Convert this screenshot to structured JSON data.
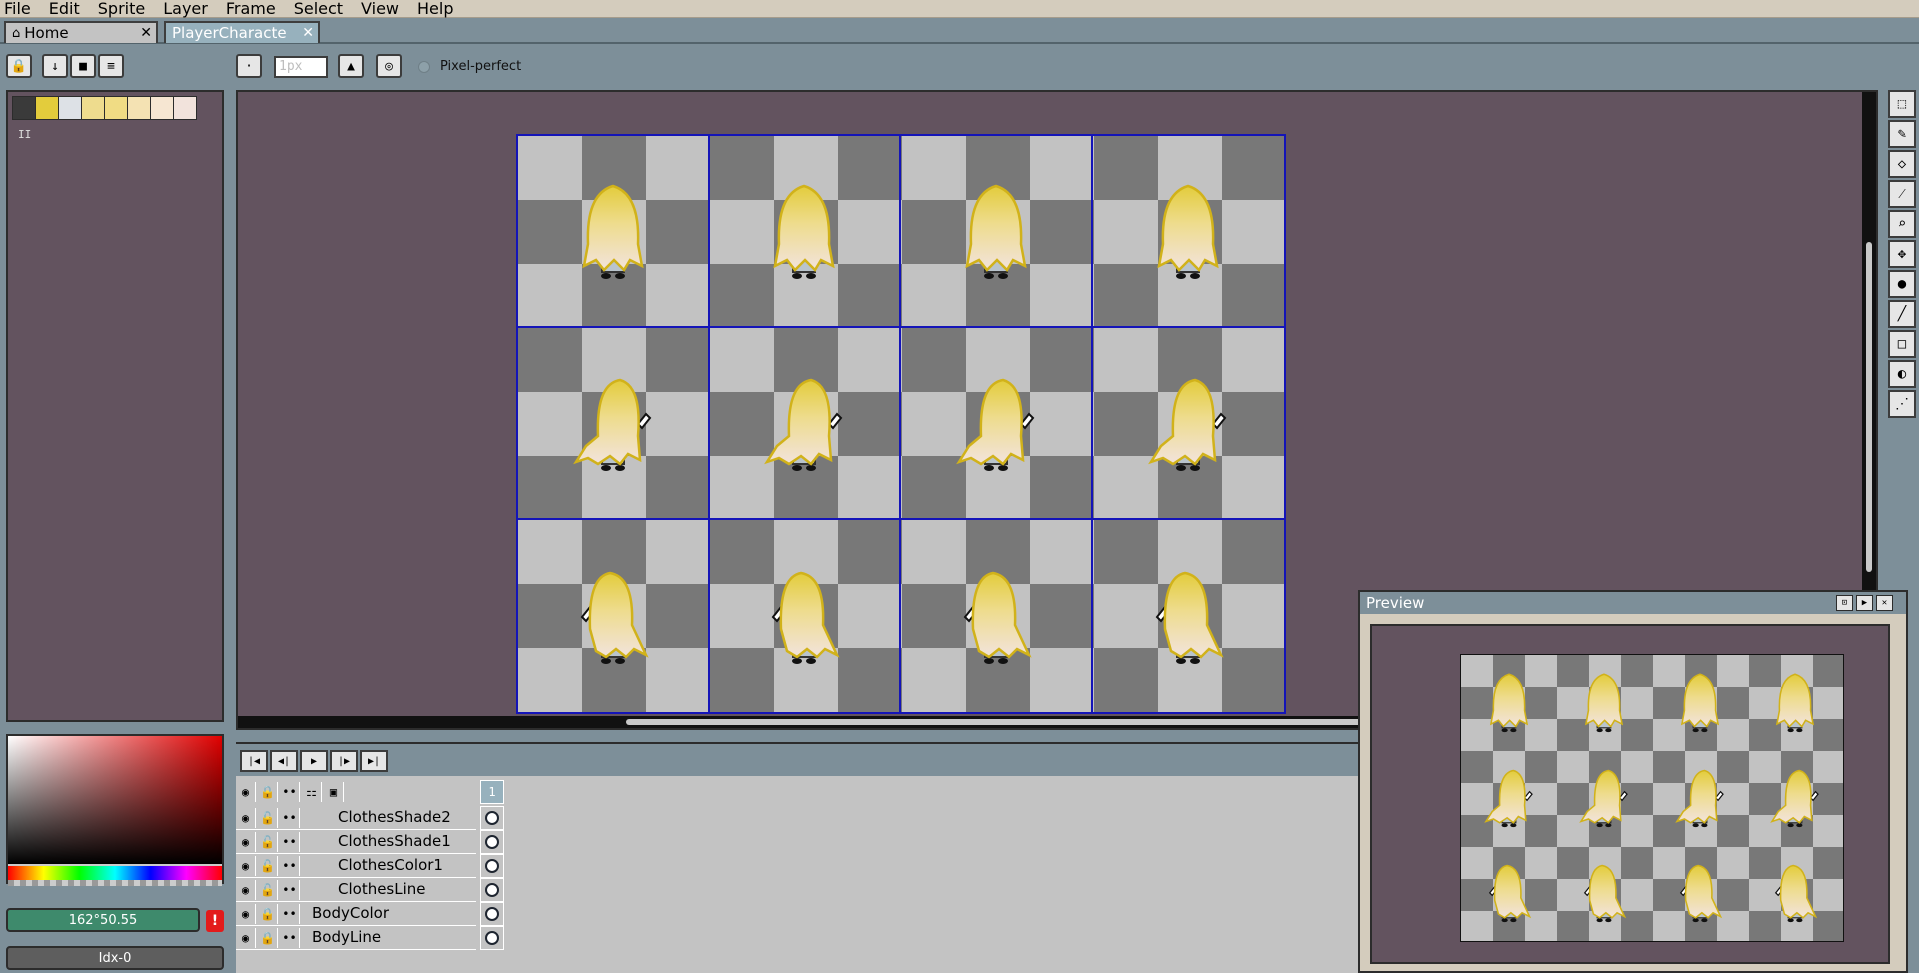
{
  "menu": [
    "File",
    "Edit",
    "Sprite",
    "Layer",
    "Frame",
    "Select",
    "View",
    "Help"
  ],
  "tabs": [
    {
      "label": "Home",
      "icon": "home-icon"
    },
    {
      "label": "PlayerCharacte",
      "icon": ""
    }
  ],
  "contextbar": {
    "brush_size_placeholder": "1px",
    "pixel_perfect_label": "Pixel-perfect"
  },
  "palette": {
    "colors": [
      "#3a3a3a",
      "#e3cc3c",
      "#dde1e6",
      "#eedc8e",
      "#f0dc84",
      "#f4e2b3",
      "#f6e6d2",
      "#f2e3dc"
    ],
    "marker": "II"
  },
  "color_fields": {
    "hsv": "162°50.55",
    "index": "Idx-0"
  },
  "timeline": {
    "frame_number": "1",
    "layers": [
      {
        "name": "ClothesShade2",
        "locked": false,
        "indent": true
      },
      {
        "name": "ClothesShade1",
        "locked": false,
        "indent": true
      },
      {
        "name": "ClothesColor1",
        "locked": false,
        "indent": true
      },
      {
        "name": "ClothesLine",
        "locked": false,
        "indent": true
      },
      {
        "name": "BodyColor",
        "locked": true,
        "indent": false
      },
      {
        "name": "BodyLine",
        "locked": true,
        "indent": false
      }
    ]
  },
  "preview": {
    "title": "Preview"
  },
  "colors": {
    "hair_top": "#e3cc3c",
    "hair_bottom": "#f2e3dc",
    "hair_outline": "#d1b21a",
    "grid_line": "#1414b8",
    "canvas_bg": "#63535f"
  }
}
